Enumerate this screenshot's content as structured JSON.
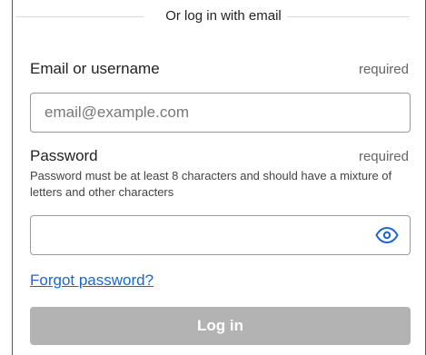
{
  "divider": {
    "text": "Or log in with email"
  },
  "email": {
    "label": "Email or username",
    "required": "required",
    "placeholder": "email@example.com",
    "value": ""
  },
  "password": {
    "label": "Password",
    "required": "required",
    "hint": "Password must be at least 8 characters and should have a mixture of letters and other characters",
    "value": "",
    "toggle_icon": "eye-icon"
  },
  "links": {
    "forgot_password": "Forgot password?"
  },
  "actions": {
    "login_label": "Log in",
    "login_enabled": false
  },
  "colors": {
    "link": "#1a66d2",
    "disabled_button": "#b3b3b3",
    "eye_icon": "#1a66d2"
  }
}
